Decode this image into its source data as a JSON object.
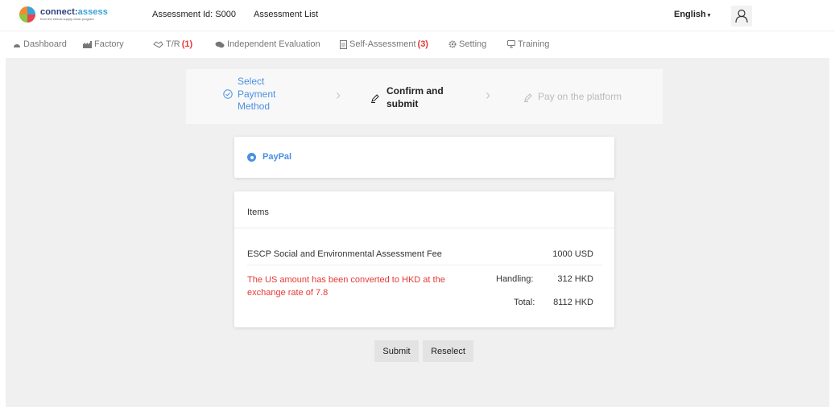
{
  "header": {
    "logo_main": "connect:",
    "logo_accent": "assess",
    "logo_sub": "from the ethical supply chain program",
    "assessment_id": "Assessment Id: S000",
    "assessment_list": "Assessment List",
    "language": "English",
    "user_icon": "user-icon"
  },
  "nav": {
    "dashboard": "Dashboard",
    "factory": "Factory",
    "tr": "T/R",
    "tr_count": "(1)",
    "independent_evaluation": "Independent Evaluation",
    "self_assessment": "Self-Assessment",
    "self_assessment_count": "(3)",
    "setting": "Setting",
    "training": "Training"
  },
  "steps": {
    "step1_line1": "Select",
    "step1_line2": "Payment",
    "step1_line3": "Method",
    "step2_line1": "Confirm and",
    "step2_line2": "submit",
    "step3": "Pay on the platform"
  },
  "payment": {
    "method": "PayPal"
  },
  "items": {
    "heading": "Items",
    "fee_label": "ESCP Social and Environmental Assessment Fee",
    "fee_amount": "1000 USD",
    "note": "The US amount has been converted to HKD at the exchange rate of 7.8",
    "handling_label": "Handling:",
    "handling_value": "312 HKD",
    "total_label": "Total:",
    "total_value": "8112 HKD"
  },
  "actions": {
    "submit": "Submit",
    "reselect": "Reselect"
  },
  "colors": {
    "accent": "#4a90e2",
    "alert": "#e53935",
    "background": "#f0f0f0"
  }
}
